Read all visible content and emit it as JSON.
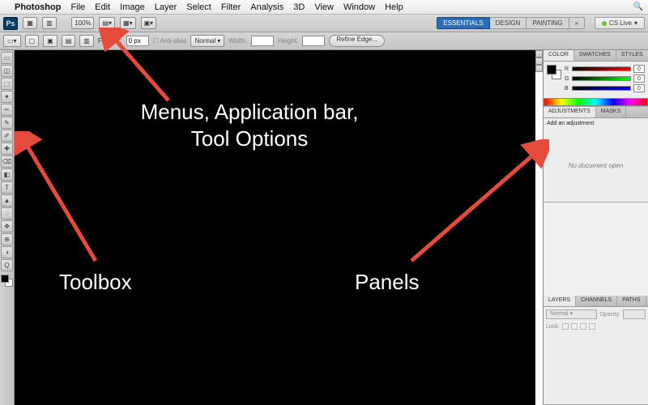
{
  "mac_menu": {
    "apple": "",
    "app_name": "Photoshop",
    "items": [
      "File",
      "Edit",
      "Image",
      "Layer",
      "Select",
      "Filter",
      "Analysis",
      "3D",
      "View",
      "Window",
      "Help"
    ]
  },
  "app_bar": {
    "logo": "Ps",
    "zoom": "100%",
    "workspaces": [
      "ESSENTIALS",
      "DESIGN",
      "PAINTING"
    ],
    "active_workspace": "ESSENTIALS",
    "cs_live": "CS Live"
  },
  "options_bar": {
    "feather_label": "Feather:",
    "feather_value": "0 px",
    "anti_alias": "Anti-alias",
    "style_label": "Normal",
    "width_label": "Width:",
    "height_label": "Height:",
    "refine": "Refine Edge..."
  },
  "tools": [
    "▭",
    "◫",
    "⬚",
    "✦",
    "✂",
    "✎",
    "✐",
    "✚",
    "⌫",
    "◧",
    "T",
    "▲",
    "◌",
    "✥",
    "⊕",
    "◑",
    "Q"
  ],
  "panels": {
    "color": {
      "tabs": [
        "COLOR",
        "SWATCHES",
        "STYLES"
      ],
      "channels": [
        {
          "label": "R",
          "value": "0"
        },
        {
          "label": "G",
          "value": "0"
        },
        {
          "label": "B",
          "value": "0"
        }
      ]
    },
    "adjustments": {
      "tabs": [
        "ADJUSTMENTS",
        "MASKS"
      ],
      "add_label": "Add an adjustment",
      "empty": "No document open"
    },
    "layers": {
      "tabs": [
        "LAYERS",
        "CHANNELS",
        "PATHS"
      ],
      "blend": "Normal",
      "opacity_label": "Opacity:",
      "lock_label": "Lock:"
    }
  },
  "annotations": {
    "menus": "Menus, Application bar, Tool Options",
    "toolbox": "Toolbox",
    "panels": "Panels"
  }
}
